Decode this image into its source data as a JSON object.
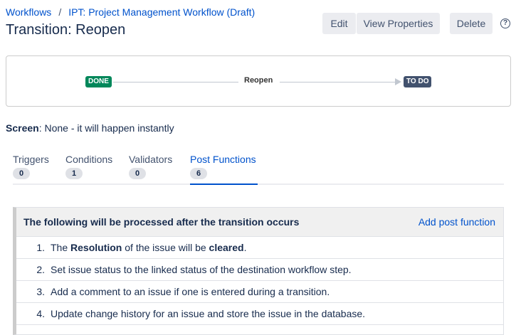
{
  "breadcrumb": {
    "root": "Workflows",
    "separator": "/",
    "workflow": "IPT: Project Management Workflow (Draft)"
  },
  "title": "Transition: Reopen",
  "buttons": {
    "edit": "Edit",
    "view_properties": "View Properties",
    "delete": "Delete",
    "help": "?"
  },
  "diagram": {
    "from": "DONE",
    "transition": "Reopen",
    "to": "TO DO",
    "from_color": "#00875a",
    "to_color": "#42526e"
  },
  "screen": {
    "label": "Screen",
    "value": ": None - it will happen instantly"
  },
  "tabs": [
    {
      "label": "Triggers",
      "count": "0"
    },
    {
      "label": "Conditions",
      "count": "1"
    },
    {
      "label": "Validators",
      "count": "0"
    },
    {
      "label": "Post Functions",
      "count": "6"
    }
  ],
  "post_functions": {
    "header": "The following will be processed after the transition occurs",
    "add_link": "Add post function",
    "items": [
      {
        "num": "1.",
        "parts": [
          "The ",
          "Resolution",
          " of the issue will be ",
          "cleared",
          "."
        ]
      },
      {
        "num": "2.",
        "text": "Set issue status to the linked status of the destination workflow step."
      },
      {
        "num": "3.",
        "text": "Add a comment to an issue if one is entered during a transition."
      },
      {
        "num": "4.",
        "text": "Update change history for an issue and store the issue in the database."
      }
    ]
  }
}
